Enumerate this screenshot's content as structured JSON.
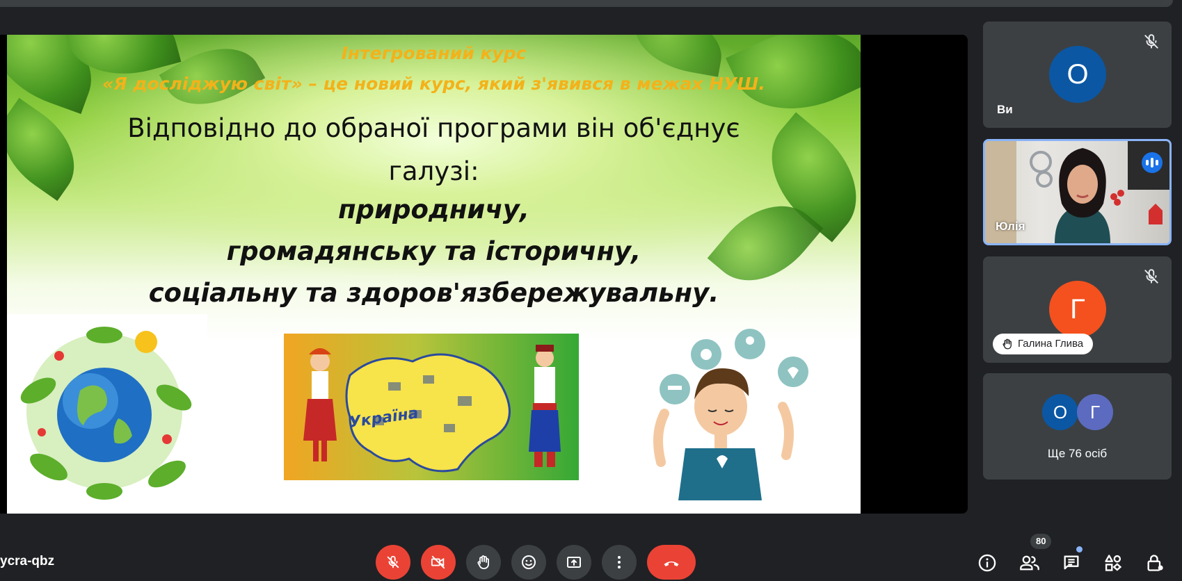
{
  "slide": {
    "title_line1": "Інтегрований курс",
    "title_line2": "«Я досліджую світ» – це новий курс, який з'явився в межах НУШ.",
    "body_line1": "Відповідно до обраної програми він об'єднує",
    "body_line2": "галузі:",
    "list": [
      "природничу,",
      "громадянську та історичну,",
      "соціальну та здоров'язбережувальну."
    ],
    "map_label": "Україна"
  },
  "participants": [
    {
      "name": "Ви",
      "avatar_letter": "О",
      "avatar_color": "#0b57a4",
      "muted": true
    },
    {
      "name": "Юлія",
      "speaking": true,
      "active_border": "#8ab4f8"
    },
    {
      "name": "Галина Глива",
      "avatar_letter": "Г",
      "avatar_color": "#f4511e",
      "muted": true,
      "hand_raised": true
    },
    {
      "others_label": "Ще 76 осіб",
      "avatar_letters": [
        "О",
        "Г"
      ],
      "avatar_colors": [
        "#0b57a4",
        "#5c6bc0"
      ]
    }
  ],
  "meeting_code": "ycra-qbz",
  "controls": {
    "mic": "mic-off-icon",
    "camera": "camera-off-icon",
    "hand": "raise-hand-icon",
    "reactions": "emoji-icon",
    "present": "present-screen-icon",
    "more": "more-options-icon",
    "hangup": "hang-up-icon"
  },
  "people_count": "80",
  "colors": {
    "danger": "#ea4335",
    "accent": "#1a73e8",
    "surface": "#3c4043",
    "background": "#202124"
  }
}
